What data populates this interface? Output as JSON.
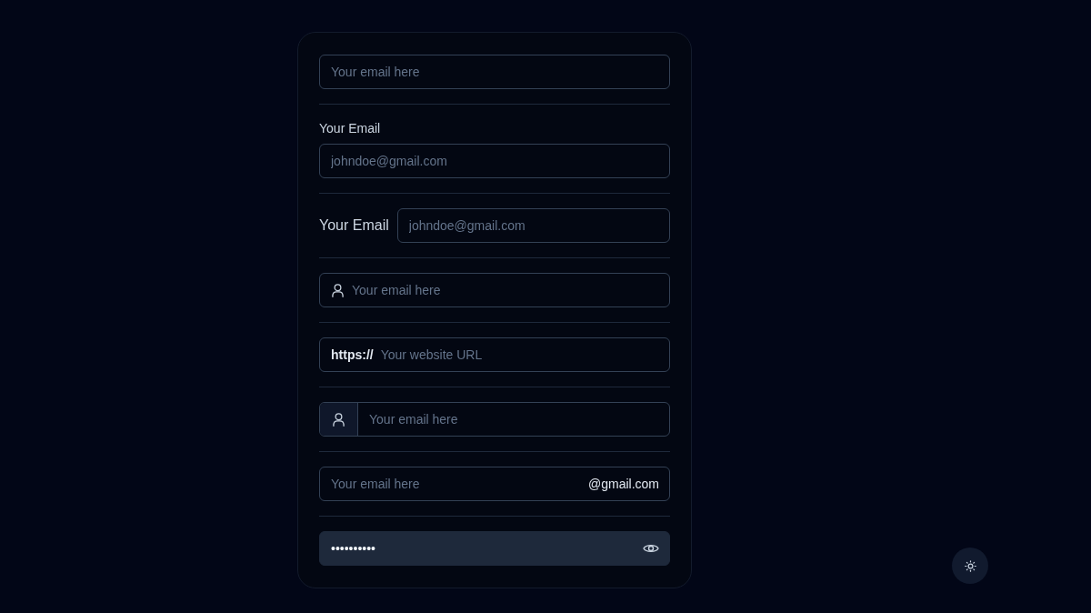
{
  "fields": [
    {
      "kind": "plain",
      "placeholder": "Your email here"
    },
    {
      "kind": "stacked_label",
      "label": "Your Email",
      "placeholder": "johndoe@gmail.com"
    },
    {
      "kind": "inline_label",
      "label": "Your Email",
      "placeholder": "johndoe@gmail.com"
    },
    {
      "kind": "leading_icon",
      "placeholder": "Your email here"
    },
    {
      "kind": "prefix",
      "prefix": "https://",
      "placeholder": "Your website URL"
    },
    {
      "kind": "icon_addon",
      "placeholder": "Your email here"
    },
    {
      "kind": "suffix",
      "suffix": "@gmail.com",
      "placeholder": "Your email here"
    },
    {
      "kind": "password",
      "value": "••••••••••"
    }
  ]
}
